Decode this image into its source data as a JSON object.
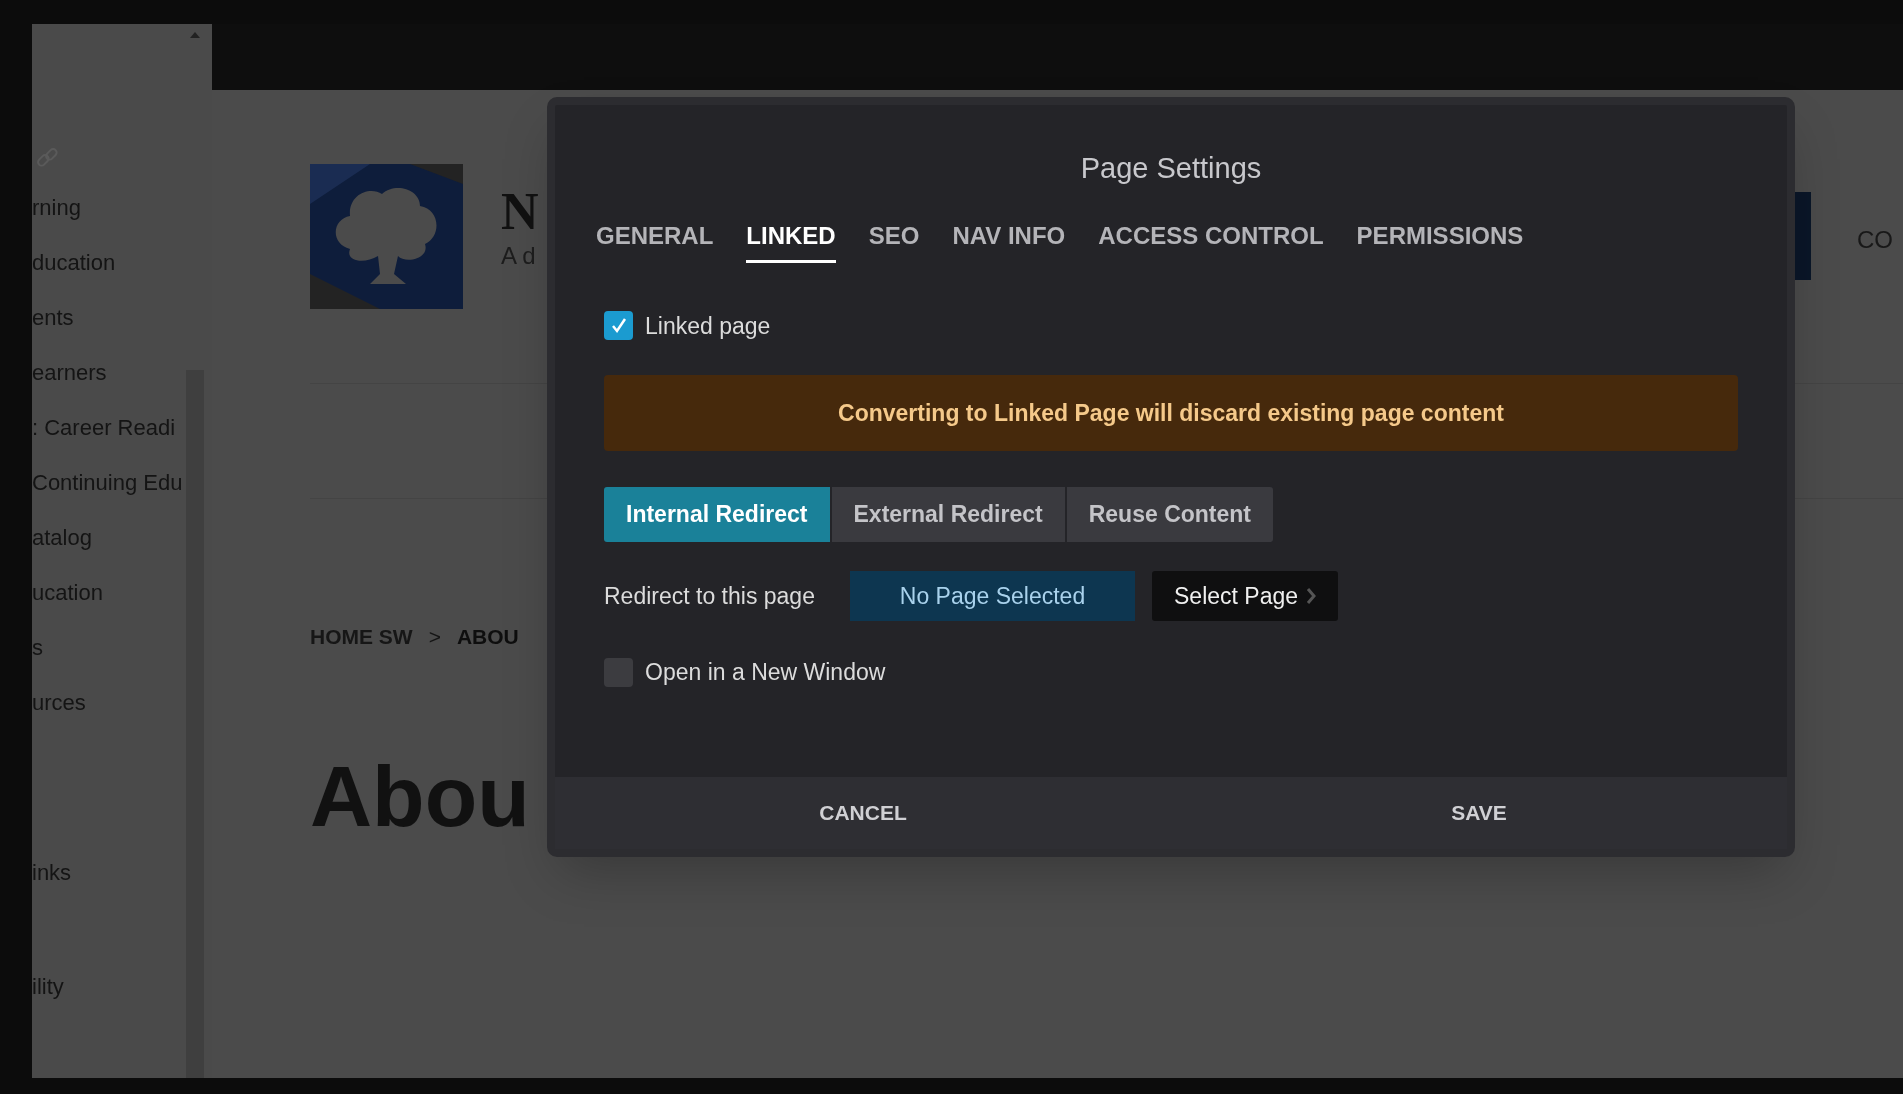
{
  "sidebar": {
    "items": [
      "rning",
      "ducation",
      "ents",
      "earners",
      ": Career Readi",
      "Continuing Edu",
      "atalog",
      "ucation",
      "s",
      "urces",
      "inks",
      "ility"
    ]
  },
  "header": {
    "title": "N",
    "subtitle": "A d",
    "nav_item": "CO"
  },
  "breadcrumb": {
    "items": [
      "HOME SW",
      "ABOU"
    ],
    "separator": ">"
  },
  "page_heading": "Abou",
  "modal": {
    "title": "Page Settings",
    "tabs": [
      {
        "label": "GENERAL",
        "selected": false
      },
      {
        "label": "LINKED",
        "selected": true
      },
      {
        "label": "SEO",
        "selected": false
      },
      {
        "label": "NAV INFO",
        "selected": false
      },
      {
        "label": "ACCESS CONTROL",
        "selected": false
      },
      {
        "label": "PERMISSIONS",
        "selected": false
      }
    ],
    "linked_page": {
      "label": "Linked page",
      "checked": true
    },
    "warning": "Converting to Linked Page will discard existing page content",
    "redirect_types": [
      {
        "label": "Internal Redirect",
        "selected": true
      },
      {
        "label": "External Redirect",
        "selected": false
      },
      {
        "label": "Reuse Content",
        "selected": false
      }
    ],
    "redirect": {
      "label": "Redirect to this page",
      "value": "No Page Selected",
      "button": "Select Page"
    },
    "new_window": {
      "label": "Open in a New Window",
      "checked": false
    },
    "footer": {
      "cancel": "CANCEL",
      "save": "SAVE"
    }
  }
}
